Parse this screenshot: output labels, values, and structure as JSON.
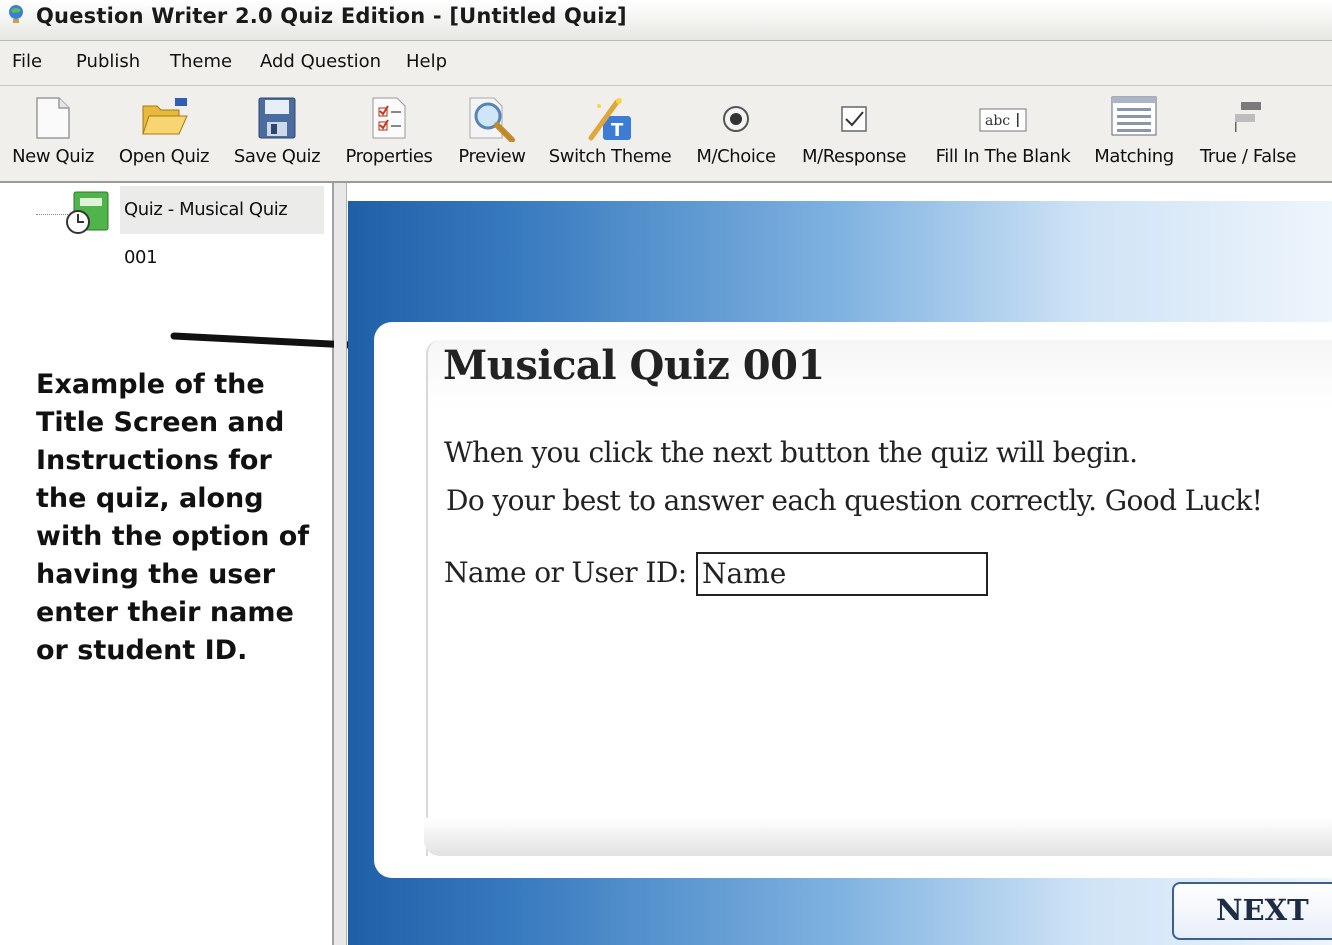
{
  "window": {
    "title": "Question Writer 2.0 Quiz Edition - [Untitled Quiz]",
    "app_icon": "bulb-globe-icon"
  },
  "menu": {
    "items": [
      {
        "label": "File"
      },
      {
        "label": "Publish"
      },
      {
        "label": "Theme"
      },
      {
        "label": "Add Question"
      },
      {
        "label": "Help"
      }
    ]
  },
  "toolbar": {
    "items": [
      {
        "label": "New Quiz",
        "icon": "new-document-icon"
      },
      {
        "label": "Open Quiz",
        "icon": "open-folder-icon"
      },
      {
        "label": "Save Quiz",
        "icon": "floppy-disk-icon"
      },
      {
        "label": "Properties",
        "icon": "checklist-icon"
      },
      {
        "label": "Preview",
        "icon": "magnifier-icon"
      },
      {
        "label": "Switch Theme",
        "icon": "magic-wand-icon"
      },
      {
        "label": "M/Choice",
        "icon": "radio-button-icon"
      },
      {
        "label": "M/Response",
        "icon": "checkbox-icon"
      },
      {
        "label": "Fill In The Blank",
        "icon": "text-field-icon"
      },
      {
        "label": "Matching",
        "icon": "list-icon"
      },
      {
        "label": "True / False",
        "icon": "flag-icon"
      }
    ]
  },
  "tree": {
    "root_label": "Quiz - Musical Quiz 001",
    "root_icon": "quiz-timer-icon"
  },
  "annotation": {
    "text": "Example of the Title Screen and Instructions for the quiz, along with the option of having the user enter their name or student ID."
  },
  "preview": {
    "quiz_title": "Musical Quiz 001",
    "instruction_1": "When you click the next button the quiz will begin.",
    "instruction_2": "Do your best to answer  each question correctly. Good Luck!",
    "name_label": "Name or User ID:",
    "name_value": "Name",
    "next_label": "NEXT"
  },
  "colors": {
    "preview_blue": "#1f5fa8",
    "preview_light": "#cfe3f6",
    "next_border": "#3b5f8f"
  }
}
